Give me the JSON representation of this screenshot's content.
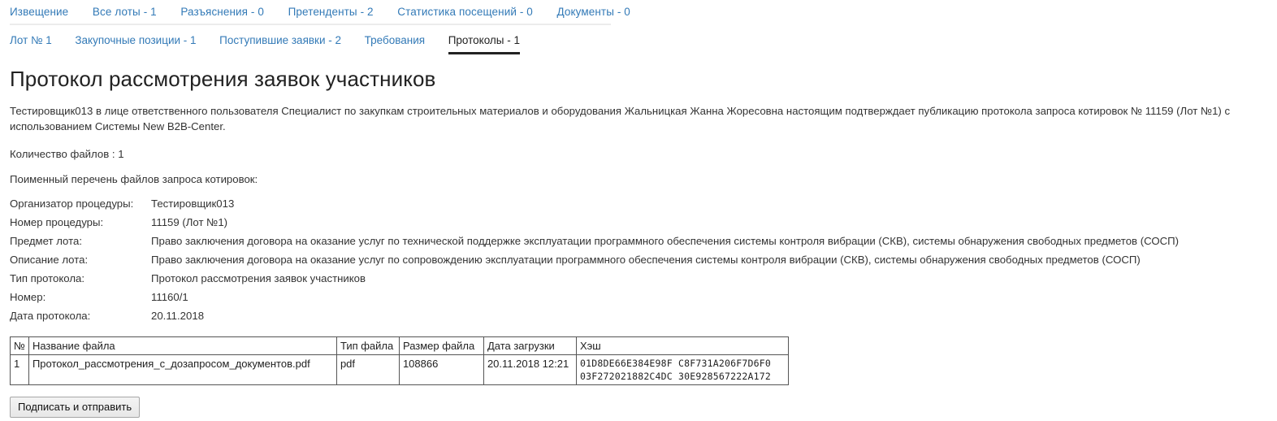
{
  "topnav": {
    "items": [
      {
        "label": "Извещение"
      },
      {
        "label": "Все лоты - 1"
      },
      {
        "label": "Разъяснения - 0"
      },
      {
        "label": "Претенденты - 2"
      },
      {
        "label": "Статистика посещений - 0"
      },
      {
        "label": "Документы - 0"
      }
    ]
  },
  "tabs": {
    "items": [
      {
        "label": "Лот № 1",
        "active": false
      },
      {
        "label": "Закупочные позиции - 1",
        "active": false
      },
      {
        "label": "Поступившие заявки - 2",
        "active": false
      },
      {
        "label": "Требования",
        "active": false
      },
      {
        "label": "Протоколы - 1",
        "active": true
      }
    ]
  },
  "document": {
    "title": "Протокол рассмотрения заявок участников",
    "intro": "Тестировщик013 в лице ответственного пользователя Специалист по закупкам строительных материалов и оборудования Жальницкая Жанна Жоресовна настоящим подтверждает публикацию протокола запроса котировок № 11159 (Лот №1) с использованием Системы New B2B-Center.",
    "file_count_line": "Количество файлов : 1",
    "file_list_heading": "Поименный перечень файлов запроса котировок:",
    "meta": [
      {
        "key": "Организатор процедуры:",
        "value": "Тестировщик013"
      },
      {
        "key": "Номер процедуры:",
        "value": "11159 (Лот №1)"
      },
      {
        "key": "Предмет лота:",
        "value": "Право заключения договора на оказание услуг по технической поддержке эксплуатации программного обеспечения системы контроля вибрации (СКВ), системы обнаружения свободных предметов (СОСП)"
      },
      {
        "key": "Описание лота:",
        "value": "Право заключения договора на оказание услуг по сопровождению эксплуатации программного обеспечения системы контроля вибрации (СКВ), системы обнаружения свободных предметов (СОСП)"
      },
      {
        "key": "Тип протокола:",
        "value": "Протокол рассмотрения заявок участников"
      },
      {
        "key": "Номер:",
        "value": "11160/1"
      },
      {
        "key": "Дата протокола:",
        "value": "20.11.2018"
      }
    ]
  },
  "files_table": {
    "columns": [
      {
        "label": "№"
      },
      {
        "label": "Название файла"
      },
      {
        "label": "Тип файла"
      },
      {
        "label": "Размер файла"
      },
      {
        "label": "Дата загрузки"
      },
      {
        "label": "Хэш"
      }
    ],
    "rows": [
      {
        "num": "1",
        "name": "Протокол_рассмотрения_с_дозапросом_документов.pdf",
        "type": "pdf",
        "size": "108866",
        "date": "20.11.2018 12:21",
        "hash_line1": "01D8DE66E384E98F C8F731A206F7D6F0",
        "hash_line2": "03F272021882C4DC 30E928567222A172"
      }
    ]
  },
  "actions": {
    "submit_label": "Подписать и отправить"
  },
  "colors": {
    "link": "#337ab7",
    "text": "#333333",
    "active_tab": "#222222",
    "table_border": "#555555",
    "divider": "#ececec"
  }
}
